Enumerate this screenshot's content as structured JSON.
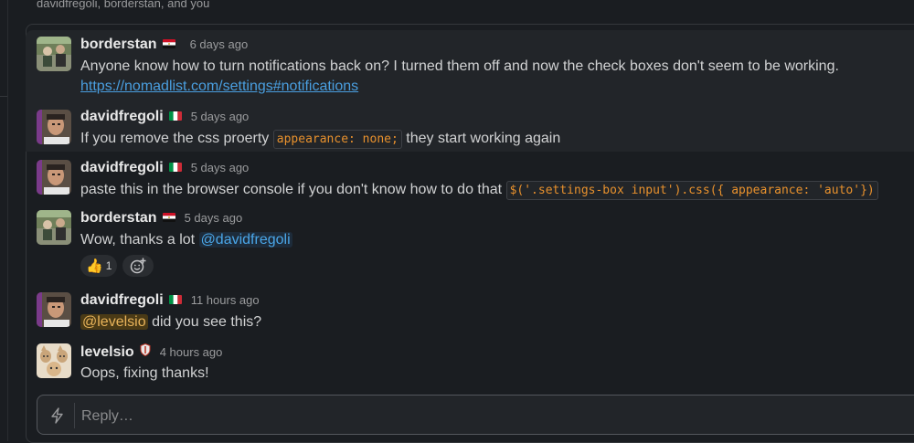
{
  "header": {
    "participants": "davidfregoli, borderstan, and you"
  },
  "messages": [
    {
      "author": "borderstan",
      "flag": "egypt",
      "time": "6 days ago",
      "text": "Anyone know how to turn notifications back on? I turned them off and now the check boxes don't seem to be working.",
      "link": "https://nomadlist.com/settings#notifications"
    },
    {
      "author": "davidfregoli",
      "flag": "italy",
      "time": "5 days ago",
      "text_before": "If you remove the css proerty",
      "code": "appearance: none;",
      "text_after": "they start working again"
    },
    {
      "author": "davidfregoli",
      "flag": "italy",
      "time": "5 days ago",
      "text_before": "paste this in the browser console if you don't know how to do that",
      "code": "$('.settings-box input').css({ appearance: 'auto'})"
    },
    {
      "author": "borderstan",
      "flag": "egypt",
      "time": "5 days ago",
      "text_before": "Wow, thanks a lot",
      "mention": "@davidfregoli",
      "reaction": {
        "emoji": "👍",
        "count": "1"
      }
    },
    {
      "author": "davidfregoli",
      "flag": "italy",
      "time": "11 hours ago",
      "mention": "@levelsio",
      "text_after": "did you see this?"
    },
    {
      "author": "levelsio",
      "flag": "shield",
      "time": "4 hours ago",
      "text": "Oops, fixing thanks!"
    }
  ],
  "reply": {
    "placeholder": "Reply…"
  },
  "colors": {
    "background": "#1a1d21",
    "highlight_row": "#222529",
    "link": "#4a9fe0",
    "code": "#e8912d",
    "mention": "#4aa6e8",
    "mention_self": "#e8b35a"
  }
}
